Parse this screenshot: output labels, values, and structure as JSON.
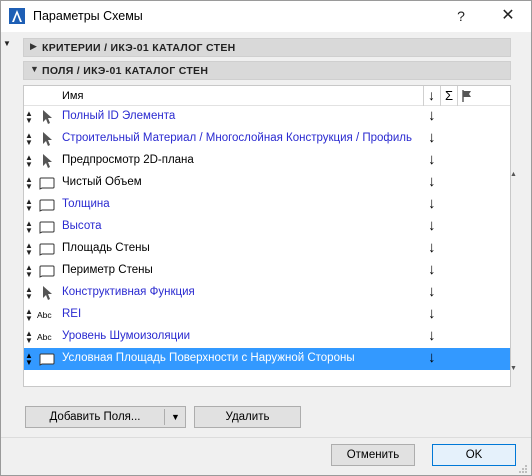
{
  "window": {
    "title": "Параметры Схемы",
    "help": "?",
    "close": "✕"
  },
  "sections": [
    {
      "label": "КРИТЕРИИ / ИКЭ-01 КАТАЛОГ СТЕН",
      "expanded": false
    },
    {
      "label": "ПОЛЯ / ИКЭ-01 КАТАЛОГ СТЕН",
      "expanded": true
    }
  ],
  "table": {
    "columns": {
      "name": "Имя",
      "sort": "↓",
      "sum": "Σ"
    },
    "rows": [
      {
        "icon": "pointer-icon",
        "label": "Полный ID Элемента",
        "blue": true,
        "sort": "↓"
      },
      {
        "icon": "pointer-icon",
        "label": "Строительный Материал / Многослойная Конструкция / Профиль",
        "blue": true,
        "sort": "↓"
      },
      {
        "icon": "pointer-icon",
        "label": "Предпросмотр 2D-плана",
        "blue": false,
        "sort": "↓"
      },
      {
        "icon": "box-icon",
        "label": "Чистый Объем",
        "blue": false,
        "sort": "↓"
      },
      {
        "icon": "box-icon",
        "label": "Толщина",
        "blue": true,
        "sort": "↓"
      },
      {
        "icon": "box-icon",
        "label": "Высота",
        "blue": true,
        "sort": "↓"
      },
      {
        "icon": "box-icon",
        "label": "Площадь Стены",
        "blue": false,
        "sort": "↓"
      },
      {
        "icon": "box-icon",
        "label": "Периметр Стены",
        "blue": false,
        "sort": "↓"
      },
      {
        "icon": "pointer-icon",
        "label": "Конструктивная Функция",
        "blue": true,
        "sort": "↓"
      },
      {
        "icon": "abc-icon",
        "label": "REI",
        "blue": true,
        "sort": "↓",
        "abc": "Abc"
      },
      {
        "icon": "abc-icon",
        "label": "Уровень Шумоизоляции",
        "blue": true,
        "sort": "↓",
        "abc": "Abc"
      },
      {
        "icon": "box-icon",
        "label": "Условная Площадь Поверхности с Наружной Стороны",
        "blue": false,
        "sort": "↓",
        "selected": true
      }
    ]
  },
  "buttons": {
    "add_fields": "Добавить Поля...",
    "delete": "Удалить",
    "cancel": "Отменить",
    "ok": "OK"
  },
  "colors": {
    "selection": "#3399ff",
    "blue_text": "#2a2ad0",
    "section_bg": "#d9d9d9"
  }
}
